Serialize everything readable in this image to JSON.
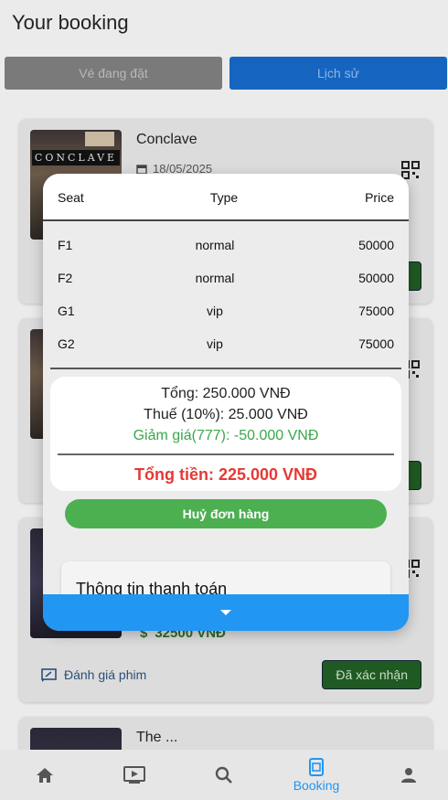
{
  "header": {
    "title": "Your booking"
  },
  "tabs": [
    {
      "label": "Vé đang đặt"
    },
    {
      "label": "Lịch sử"
    }
  ],
  "cards": [
    {
      "title": "Conclave",
      "date": "18/05/2025",
      "poster_text": "CONCLAVE"
    },
    {
      "title": "",
      "price": "32500 VNĐ",
      "rate_label": "Đánh giá phim",
      "status": "Đã xác nhận"
    },
    {
      "title": "The ..."
    }
  ],
  "dialog": {
    "headers": {
      "seat": "Seat",
      "type": "Type",
      "price": "Price"
    },
    "rows": [
      {
        "seat": "F1",
        "type": "normal",
        "price": "50000"
      },
      {
        "seat": "F2",
        "type": "normal",
        "price": "50000"
      },
      {
        "seat": "G1",
        "type": "vip",
        "price": "75000"
      },
      {
        "seat": "G2",
        "type": "vip",
        "price": "75000"
      }
    ],
    "summary": {
      "subtotal": "Tổng: 250.000 VNĐ",
      "tax": "Thuế (10%): 25.000 VNĐ",
      "discount": "Giảm giá(777): -50.000 VNĐ",
      "total": "Tổng tiền: 225.000 VNĐ"
    },
    "cancel_label": "Huỷ đơn hàng",
    "payment_title": "Thông tin thanh toán"
  },
  "nav": {
    "items": [
      {
        "icon": "home-icon",
        "label": ""
      },
      {
        "icon": "movie-icon",
        "label": ""
      },
      {
        "icon": "search-icon",
        "label": ""
      },
      {
        "icon": "booking-icon",
        "label": "Booking"
      },
      {
        "icon": "person-icon",
        "label": ""
      }
    ]
  },
  "colors": {
    "accent": "#2196f3",
    "success": "#4caf50",
    "danger": "#e53935",
    "discount": "#3aa84a"
  }
}
